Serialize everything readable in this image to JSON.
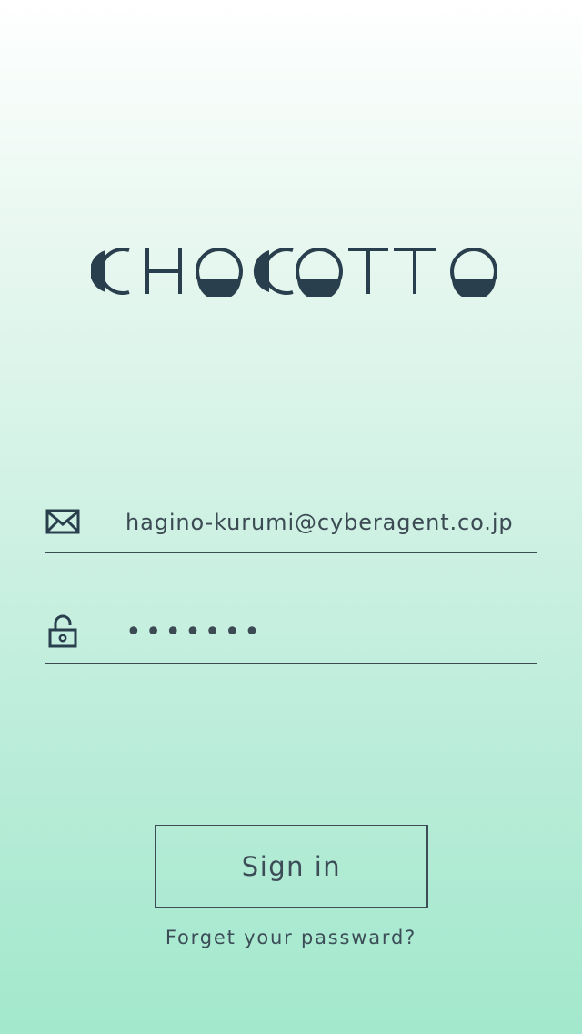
{
  "app": {
    "logo_text": "CHOCOTTO",
    "brand_color": "#2a3f4d"
  },
  "login": {
    "email": {
      "icon": "mail-icon",
      "value": "hagino-kurumi@cyberagent.co.jp"
    },
    "password": {
      "icon": "unlock-icon",
      "value": "•••••••"
    },
    "sign_in_label": "Sign in",
    "forgot_label": "Forget your passward?"
  },
  "colors": {
    "gradient_top": "#ffffff",
    "gradient_bottom": "#a2e8cd",
    "text": "#3d4d57"
  }
}
